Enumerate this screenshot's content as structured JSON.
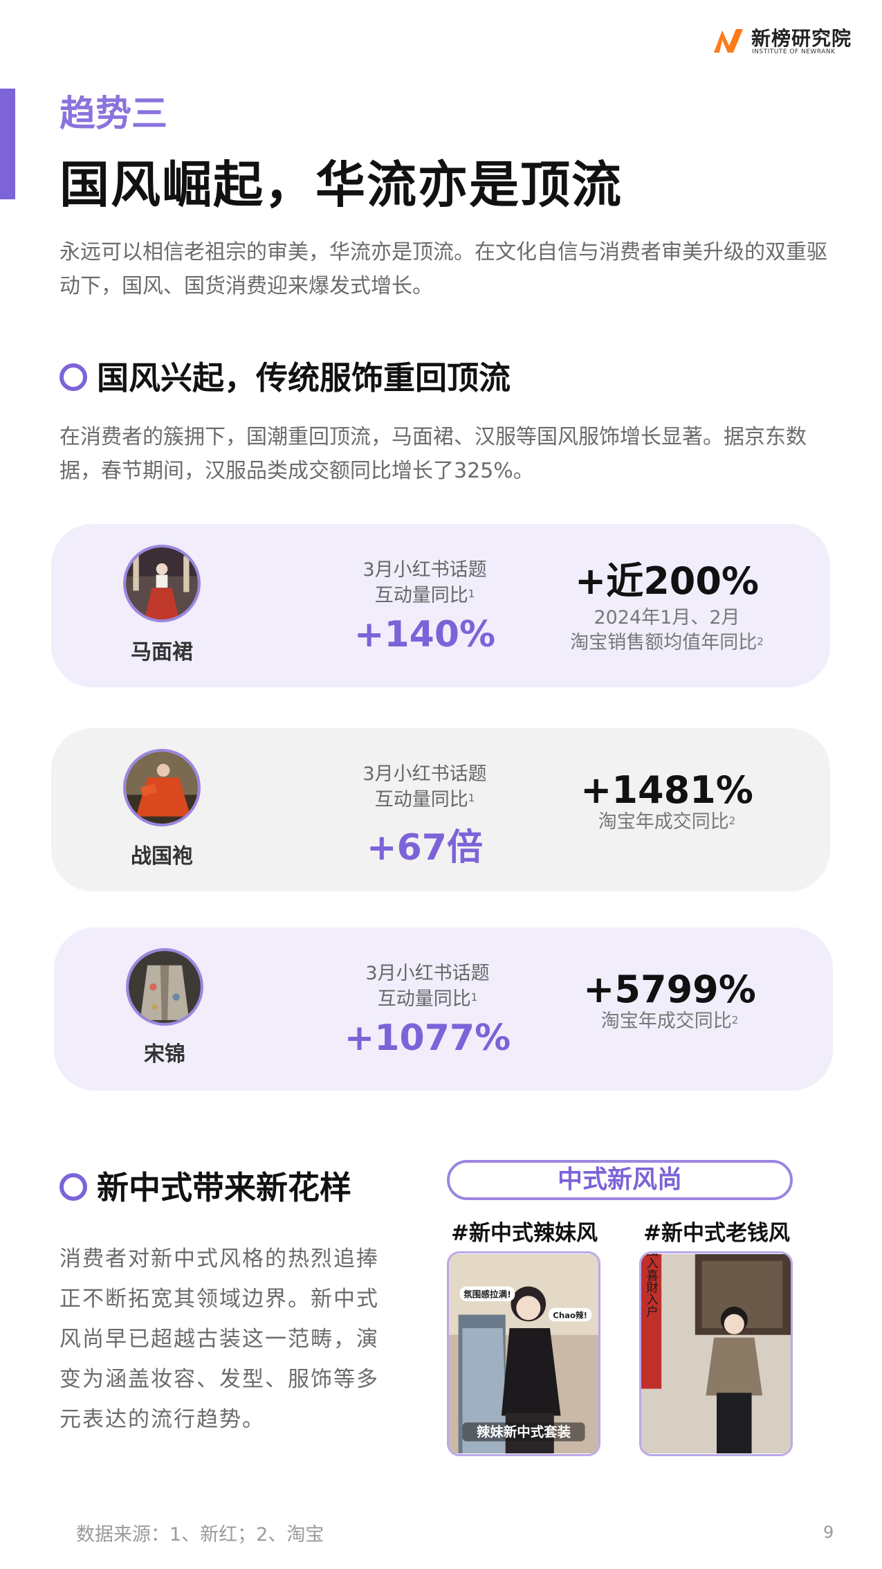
{
  "brand": {
    "name": "新榜研究院",
    "subtitle": "INSTITUTE OF NEWRANK",
    "accent": "#7c63d8",
    "logo_color": "#ff7a1a"
  },
  "header": {
    "kicker": "趋势三",
    "title": "国风崛起，华流亦是顶流",
    "intro": "永远可以相信老祖宗的审美，华流亦是顶流。在文化自信与消费者审美升级的双重驱动下，国风、国货消费迎来爆发式增长。"
  },
  "section1": {
    "title": "国风兴起，传统服饰重回顶流",
    "desc": "在消费者的簇拥下，国潮重回顶流，马面裙、汉服等国风服饰增长显著。据京东数据，春节期间，汉服品类成交额同比增长了325%。"
  },
  "cards": [
    {
      "item": "马面裙",
      "mid_line1": "3月小红书话题",
      "mid_line2": "互动量同比",
      "mid_sup": "1",
      "mid_value": "+140%",
      "right_value": "+近200%",
      "right_line1": "2024年1月、2月",
      "right_line2": "淘宝销售额均值年同比",
      "right_sup": "2"
    },
    {
      "item": "战国袍",
      "mid_line1": "3月小红书话题",
      "mid_line2": "互动量同比",
      "mid_sup": "1",
      "mid_value": "+67倍",
      "right_value": "+1481%",
      "right_line1": "",
      "right_line2": "淘宝年成交同比",
      "right_sup": "2"
    },
    {
      "item": "宋锦",
      "mid_line1": "3月小红书话题",
      "mid_line2": "互动量同比",
      "mid_sup": "1",
      "mid_value": "+1077%",
      "right_value": "+5799%",
      "right_line1": "",
      "right_line2": "淘宝年成交同比",
      "right_sup": "2"
    }
  ],
  "section2": {
    "title": "新中式带来新花样",
    "desc": "消费者对新中式风格的热烈追捧正不断拓宽其领域边界。新中式风尚早已超越古装这一范畴，演变为涵盖妆容、发型、服饰等多元表达的流行趋势。",
    "pill": "中式新风尚",
    "tags": [
      "#新中式辣妹风",
      "#新中式老钱风"
    ],
    "photo1_stickers": [
      "氛围感拉满!",
      "Chao辣!",
      "辣妹新中式套装"
    ],
    "photo2_couplet": "風入喜財入户"
  },
  "footer": {
    "source": "数据来源：1、新红；2、淘宝",
    "page": "9"
  }
}
